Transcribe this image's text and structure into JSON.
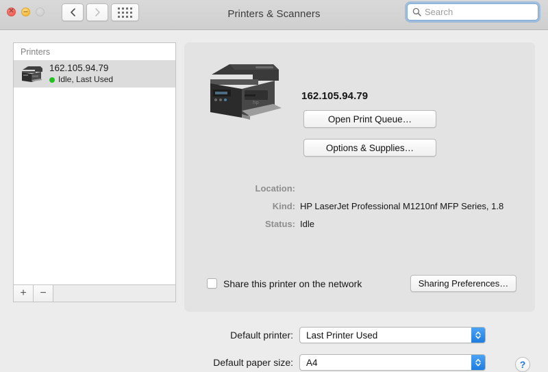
{
  "window": {
    "title": "Printers & Scanners",
    "traffic_lights": [
      {
        "name": "close",
        "glyph": "✕",
        "color": "#f1695f"
      },
      {
        "name": "minimize",
        "glyph": "−",
        "color": "#f7c045"
      },
      {
        "name": "zoom",
        "glyph": "",
        "color": "#d2d2d2"
      }
    ]
  },
  "toolbar": {
    "back_icon": "chevron-left-icon",
    "forward_icon": "chevron-right-icon",
    "show_all_icon": "grid-icon",
    "search": {
      "icon": "search-icon",
      "value": "",
      "placeholder": "Search"
    }
  },
  "sidebar": {
    "header": "Printers",
    "printers": [
      {
        "name": "162.105.94.79",
        "status": "Idle, Last Used",
        "status_color": "#23c022",
        "icon": "printer-icon",
        "selected": true
      }
    ],
    "add_button": "+",
    "remove_button": "−"
  },
  "detail": {
    "printer_icon": "printer-large-icon",
    "title": "162.105.94.79",
    "buttons": {
      "open_queue": "Open Print Queue…",
      "options_supplies": "Options & Supplies…"
    },
    "info": [
      {
        "label": "Location:",
        "value": ""
      },
      {
        "label": "Kind:",
        "value": "HP LaserJet Professional M1210nf MFP Series, 1.8"
      },
      {
        "label": "Status:",
        "value": "Idle"
      }
    ],
    "share": {
      "checked": false,
      "label": "Share this printer on the network",
      "button": "Sharing Preferences…"
    }
  },
  "bottom": {
    "default_printer": {
      "label": "Default printer:",
      "value": "Last Printer Used"
    },
    "default_paper_size": {
      "label": "Default paper size:",
      "value": "A4"
    },
    "help": "?"
  }
}
